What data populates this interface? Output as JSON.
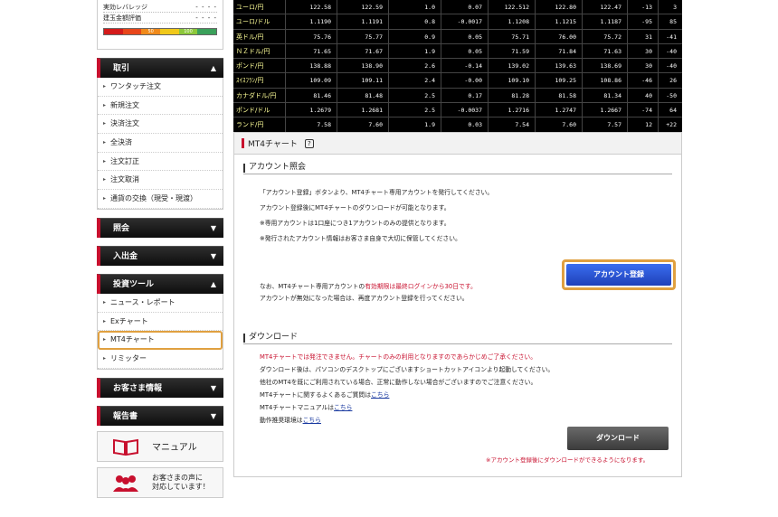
{
  "sidebar": {
    "info_rows": [
      {
        "label": "実効レバレッジ",
        "value": "- - - -"
      },
      {
        "label": "建玉金額評価",
        "value": "- - - -"
      }
    ],
    "gauge": {
      "mark1": "50",
      "mark2": "100"
    },
    "sections": {
      "trade": {
        "title": "取引",
        "items": [
          "ワンタッチ注文",
          "新規注文",
          "決済注文",
          "全決済",
          "注文訂正",
          "注文取消",
          "通貨の交換（現受・現渡）"
        ]
      },
      "inquiry": {
        "title": "照会"
      },
      "deposit": {
        "title": "入出金"
      },
      "tools": {
        "title": "投資ツール",
        "items": [
          "ニュース・レポート",
          "Exチャート",
          "MT4チャート",
          "リミッター"
        ]
      },
      "customer": {
        "title": "お客さま情報"
      },
      "report": {
        "title": "報告書"
      }
    },
    "manual_label": "マニュアル",
    "voice_label_1": "お客さまの声に",
    "voice_label_2": "対応しています！"
  },
  "rates": [
    [
      "ユーロ/円",
      "122.58",
      "122.59",
      "1.0",
      "0.07",
      "122.512",
      "122.80",
      "122.47",
      "-13",
      "3"
    ],
    [
      "ユーロ/ドル",
      "1.1190",
      "1.1191",
      "0.8",
      "-0.0017",
      "1.1208",
      "1.1215",
      "1.1187",
      "-95",
      "85"
    ],
    [
      "英ドル/円",
      "75.76",
      "75.77",
      "0.9",
      "0.05",
      "75.71",
      "76.00",
      "75.72",
      "31",
      "-41"
    ],
    [
      "ＮＺドル/円",
      "71.65",
      "71.67",
      "1.9",
      "0.05",
      "71.59",
      "71.84",
      "71.63",
      "30",
      "-40"
    ],
    [
      "ポンド/円",
      "138.88",
      "138.90",
      "2.6",
      "-0.14",
      "139.02",
      "139.63",
      "138.69",
      "30",
      "-40"
    ],
    [
      "ｽｲｽﾌﾗﾝ/円",
      "109.09",
      "109.11",
      "2.4",
      "-0.00",
      "109.10",
      "109.25",
      "108.86",
      "-46",
      "26"
    ],
    [
      "カナダドル/円",
      "81.46",
      "81.48",
      "2.5",
      "0.17",
      "81.28",
      "81.58",
      "81.34",
      "40",
      "-50"
    ],
    [
      "ポンド/ドル",
      "1.2679",
      "1.2681",
      "2.5",
      "-0.0037",
      "1.2716",
      "1.2747",
      "1.2667",
      "-74",
      "64"
    ],
    [
      "ランド/円",
      "7.58",
      "7.60",
      "1.9",
      "0.03",
      "7.54",
      "7.60",
      "7.57",
      "12",
      "+22"
    ]
  ],
  "panel": {
    "title": "MT4チャート",
    "help": "?",
    "account": {
      "heading": "アカウント照会",
      "line1": "「アカウント登録」ボタンより、MT4チャート専用アカウントを発行してください。",
      "line2": "アカウント登録後にMT4チャートのダウンロードが可能となります。",
      "line3": "※専用アカウントは1口座につき1アカウントのみの提供となります。",
      "line4": "※発行されたアカウント情報はお客さま自身で大切に保管してください。",
      "note1_prefix": "なお、MT4チャート専用アカウントの",
      "note1_red": "有効期限は最終ログインから30日です。",
      "note2": "アカウントが無効になった場合は、再度アカウント登録を行ってください。",
      "register_button": "アカウント登録"
    },
    "download": {
      "heading": "ダウンロード",
      "line1": "MT4チャートでは発注できません。チャートのみの利用となりますのであらかじめご了承ください。",
      "line2": "ダウンロード後は、パソコンのデスクトップにございますショートカットアイコンより起動してください。",
      "line3": "他社のMT4を既にご利用されている場合、正常に動作しない場合がございますのでご注意ください。",
      "line4_prefix": "MT4チャートに関するよくあるご質問は",
      "line5_prefix": "MT4チャートマニュアルは",
      "line6_prefix": "動作推奨環境は",
      "link": "こちら",
      "download_button": "ダウンロード",
      "note": "※アカウント登録後にダウンロードができるようになります。"
    }
  },
  "colors": {
    "accent_red": "#c8102e",
    "highlight_orange": "#e0a040",
    "button_blue": "#2a52d6"
  }
}
